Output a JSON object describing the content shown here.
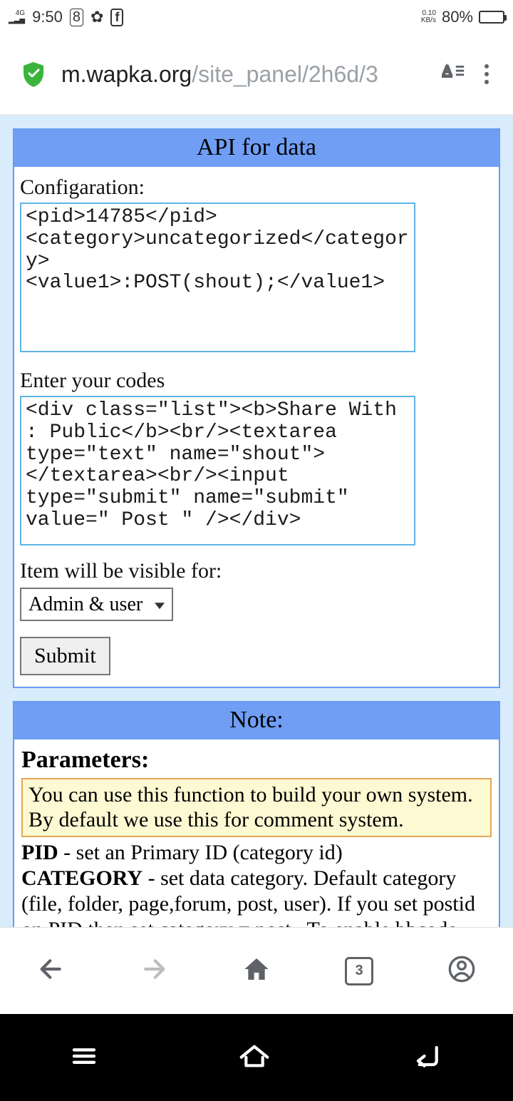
{
  "status": {
    "network": "4G",
    "time": "9:50",
    "speed_top": "0.10",
    "speed_unit": "KB/s",
    "battery_pct": "80%",
    "battery_fill": 80
  },
  "browser": {
    "host": "m.wapka.org",
    "path": "/site_panel/2h6d/3",
    "tab_count": "3"
  },
  "panel1": {
    "title": "API for data",
    "label_cfg": "Configaration:",
    "cfg_value": "<pid>14785</pid>\n<category>uncategorized</category>\n<value1>:POST(shout);</value1>",
    "label_codes": "Enter your codes",
    "codes_value": "<div class=\"list\"><b>Share With : Public</b><br/><textarea type=\"text\" name=\"shout\"></textarea><br/><input type=\"submit\" name=\"submit\" value=\" Post \" /></div>",
    "label_vis": "Item will be visible for:",
    "select_value": "Admin & user",
    "submit": "Submit"
  },
  "panel2": {
    "title": "Note:",
    "heading": "Parameters:",
    "info": "You can use this function to build your own system. By default we use this for comment system.",
    "pid_b": "PID",
    "pid_t": " - set an Primary ID (category id)",
    "cat_b": "CATEGORY",
    "cat_t": " - set data category. Default category (file, folder, page,forum, post, user). If you set postid on PID then set category = post . To enable bbcode you"
  }
}
